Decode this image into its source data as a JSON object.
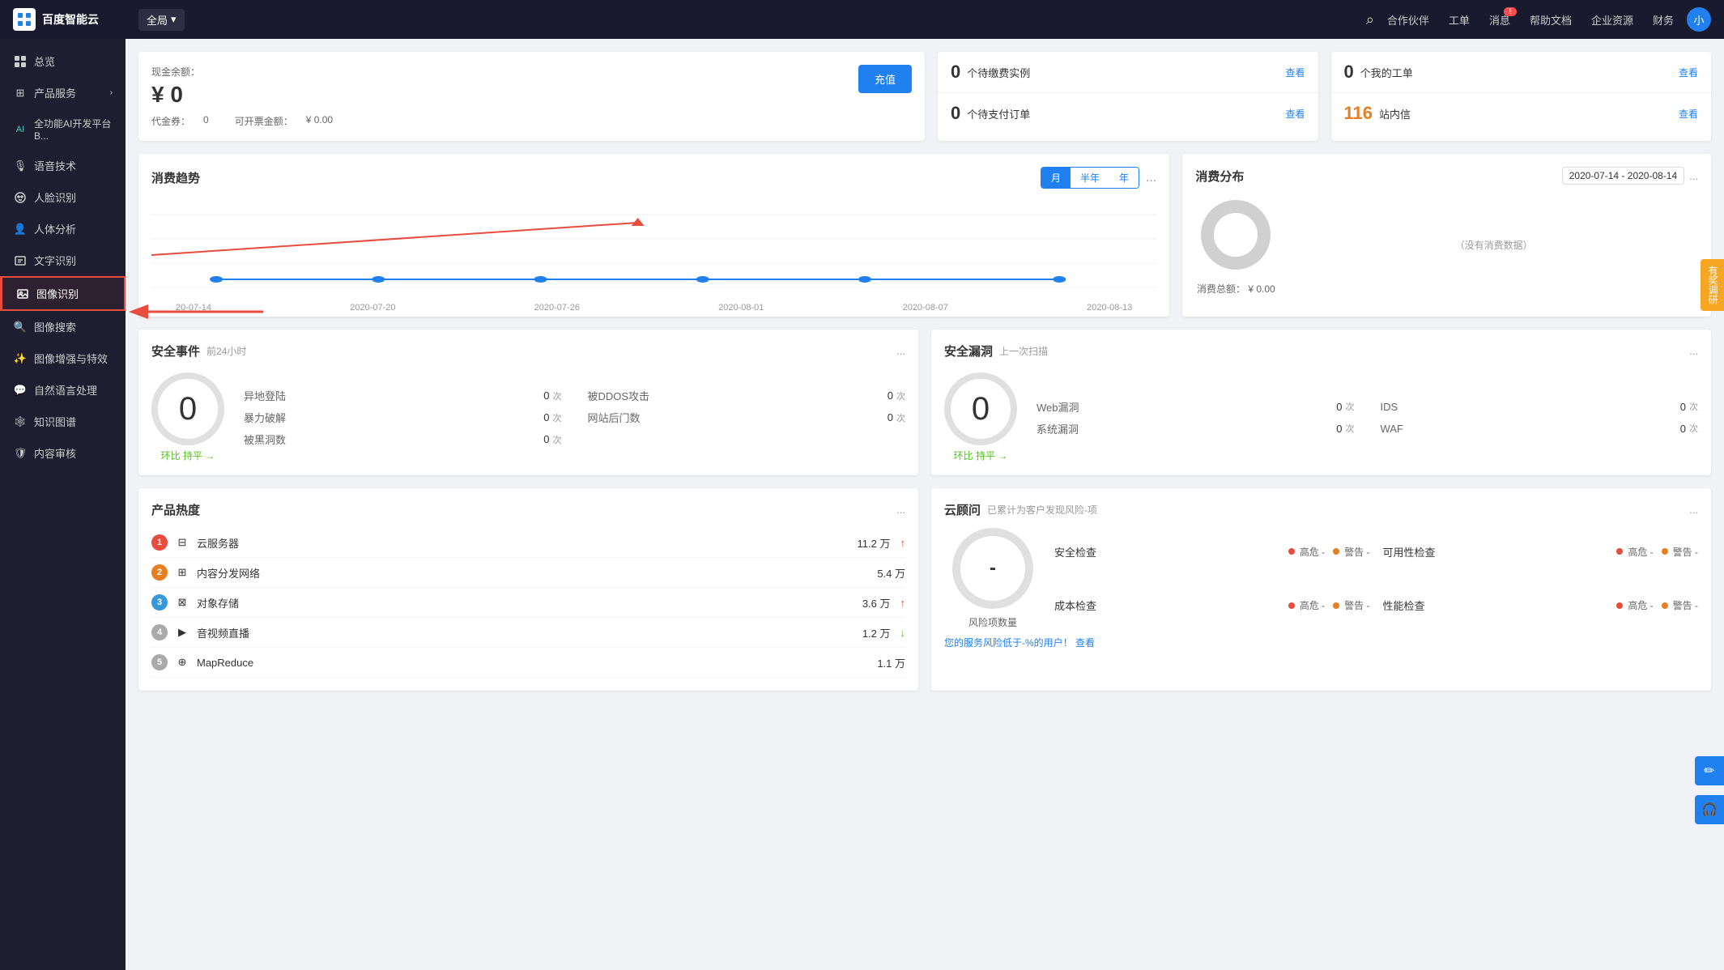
{
  "header": {
    "logo_text": "百度智能云",
    "region": "全局",
    "search_label": "搜索",
    "nav": [
      {
        "label": "合作伙伴",
        "badge": null
      },
      {
        "label": "工单",
        "badge": null
      },
      {
        "label": "消息",
        "badge": "!"
      },
      {
        "label": "帮助文档",
        "badge": null
      },
      {
        "label": "企业资源",
        "badge": null
      },
      {
        "label": "财务",
        "badge": null
      }
    ],
    "avatar": "小"
  },
  "sidebar": {
    "items": [
      {
        "label": "总览",
        "icon": "grid",
        "active": false
      },
      {
        "label": "产品服务",
        "icon": "apps",
        "active": false,
        "arrow": true
      },
      {
        "label": "全功能AI开发平台B...",
        "icon": "ai",
        "active": false
      },
      {
        "label": "语音技术",
        "icon": "mic",
        "active": false
      },
      {
        "label": "人脸识别",
        "icon": "face",
        "active": false
      },
      {
        "label": "人体分析",
        "icon": "person",
        "active": false
      },
      {
        "label": "文字识别",
        "icon": "text",
        "active": false
      },
      {
        "label": "图像识别",
        "icon": "image",
        "active": true,
        "highlight": true
      },
      {
        "label": "图像搜索",
        "icon": "search-img",
        "active": false
      },
      {
        "label": "图像增强与特效",
        "icon": "enhance",
        "active": false
      },
      {
        "label": "自然语言处理",
        "icon": "nlp",
        "active": false
      },
      {
        "label": "知识图谱",
        "icon": "kg",
        "active": false
      },
      {
        "label": "内容审核",
        "icon": "audit",
        "active": false
      }
    ]
  },
  "balance": {
    "label": "现金余额：",
    "amount": "¥ 0",
    "voucher_label": "代金券：",
    "voucher_val": "0",
    "invoice_label": "可开票金额：",
    "invoice_val": "¥ 0.00",
    "recharge_label": "充值"
  },
  "stats_left": {
    "pending_instances_num": "0",
    "pending_instances_label": "个待缴费实例",
    "pending_instances_link": "查看",
    "pending_orders_num": "0",
    "pending_orders_label": "个待支付订单",
    "pending_orders_link": "查看"
  },
  "stats_right": {
    "my_orders_num": "0",
    "my_orders_label": "个我的工单",
    "my_orders_link": "查看",
    "messages_num": "116",
    "messages_label": "站内信",
    "messages_link": "查看"
  },
  "trend": {
    "title": "消费趋势",
    "tabs": [
      "月",
      "半年",
      "年"
    ],
    "active_tab": 0,
    "x_labels": [
      "20-07-14",
      "2020-07-20",
      "2020-07-26",
      "2020-08-01",
      "2020-08-07",
      "2020-08-13"
    ],
    "more": "..."
  },
  "distribution": {
    "title": "消费分布",
    "date_range": "2020-07-14 - 2020-08-14",
    "no_data": "（没有消费数据）",
    "total_label": "消费总额：",
    "total_val": "¥ 0.00",
    "more": "..."
  },
  "security_events": {
    "title": "安全事件",
    "sub": "前24小时",
    "count": "0",
    "compare": "环比 持平 →",
    "items": [
      {
        "label": "异地登陆",
        "val": "0",
        "unit": "次"
      },
      {
        "label": "被DDOS攻击",
        "val": "0",
        "unit": "次"
      },
      {
        "label": "暴力破解",
        "val": "0",
        "unit": "次"
      },
      {
        "label": "网站后门数",
        "val": "0",
        "unit": "次"
      },
      {
        "label": "被黑洞数",
        "val": "0",
        "unit": "次"
      }
    ],
    "more": "..."
  },
  "security_vuln": {
    "title": "安全漏洞",
    "sub": "上一次扫描",
    "count": "0",
    "compare": "环比 持平 →",
    "items": [
      {
        "label": "Web漏洞",
        "val": "0",
        "unit": "次"
      },
      {
        "label": "IDS",
        "val": "0",
        "unit": "次"
      },
      {
        "label": "系统漏洞",
        "val": "0",
        "unit": "次"
      },
      {
        "label": "WAF",
        "val": "0",
        "unit": "次"
      }
    ],
    "more": "..."
  },
  "product_heat": {
    "title": "产品热度",
    "more": "...",
    "items": [
      {
        "rank": 1,
        "icon": "cloud-server",
        "name": "云服务器",
        "val": "11.2 万",
        "trend": "up"
      },
      {
        "rank": 2,
        "icon": "cdn",
        "name": "内容分发网络",
        "val": "5.4 万",
        "trend": null
      },
      {
        "rank": 3,
        "icon": "storage",
        "name": "对象存储",
        "val": "3.6 万",
        "trend": "up"
      },
      {
        "rank": 4,
        "icon": "media",
        "name": "音视频直播",
        "val": "1.2 万",
        "trend": "down"
      },
      {
        "rank": 5,
        "icon": "mapreduce",
        "name": "MapReduce",
        "val": "1.1 万",
        "trend": null
      }
    ]
  },
  "cloud_advisor": {
    "title": "云顾问",
    "sub": "已累计为客户发现风险-项",
    "gauge_val": "-",
    "gauge_label": "风险项数量",
    "footer": "您的服务风险低于-%的用户！",
    "footer_link": "查看",
    "items": [
      {
        "label": "安全检查",
        "high": "高危 -",
        "warn": "警告 -"
      },
      {
        "label": "可用性检查",
        "high": "高危 -",
        "warn": "警告 -"
      },
      {
        "label": "成本检查",
        "high": "高危 -",
        "warn": "警告 -"
      },
      {
        "label": "性能检查",
        "high": "高危 -",
        "warn": "警告 -"
      }
    ],
    "more": "..."
  },
  "float_buttons": {
    "promo": "有奖调研",
    "edit": "✏",
    "headset": "🎧"
  }
}
